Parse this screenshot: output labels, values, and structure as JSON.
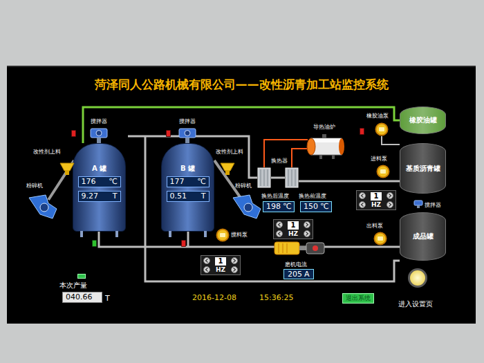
{
  "header": {
    "title": "菏泽同人公路机械有限公司——改性沥青加工站监控系统"
  },
  "reactors": [
    {
      "name": "A 罐",
      "agitator": "搅拌器",
      "temperature": "176",
      "temperature_unit": "℃",
      "weight": "9.27",
      "weight_unit": "T",
      "feeder": "改性剂上料",
      "crusher": "粉碎机"
    },
    {
      "name": "B 罐",
      "agitator": "搅拌器",
      "temperature": "177",
      "temperature_unit": "℃",
      "weight": "0.51",
      "weight_unit": "T",
      "feeder": "改性剂上料",
      "crusher": "粉碎机"
    }
  ],
  "heater": {
    "label": "导热油炉"
  },
  "heat_exchanger": {
    "label": "换热器",
    "readings": [
      {
        "label": "换热后温度",
        "value": "198",
        "unit": "℃"
      },
      {
        "label": "换热前温度",
        "value": "150",
        "unit": "℃"
      }
    ]
  },
  "storage_tanks": [
    {
      "name": "橡胶油罐",
      "pump": "橡胶油泵",
      "color": "#5f9e3c"
    },
    {
      "name": "基质沥青罐",
      "pump": "进料泵",
      "color": "#2e2e2e"
    },
    {
      "name": "成品罐",
      "pump": "出料泵",
      "color": "#2e2e2e",
      "agitator": "搅拌器"
    }
  ],
  "mixing_pump": {
    "label": "搅料泵"
  },
  "frequency_controls": [
    {
      "value": "1",
      "unit": "HZ"
    },
    {
      "value": "1",
      "unit": "HZ"
    },
    {
      "value": "1",
      "unit": "HZ"
    }
  ],
  "mill": {
    "current_label": "磨机电流",
    "current": "205",
    "unit": "A"
  },
  "valves": [
    {
      "open": false
    },
    {
      "open": false
    },
    {
      "open": false
    },
    {
      "open": true
    },
    {
      "open": false
    }
  ],
  "production": {
    "label": "本次产量",
    "value": "040.66",
    "unit": "T",
    "indicator_on": true
  },
  "clock": {
    "date": "2016-12-08",
    "time": "15:36:25"
  },
  "buttons": [
    {
      "label": "退出系统"
    }
  ],
  "settings": {
    "label": "进入设置页"
  }
}
